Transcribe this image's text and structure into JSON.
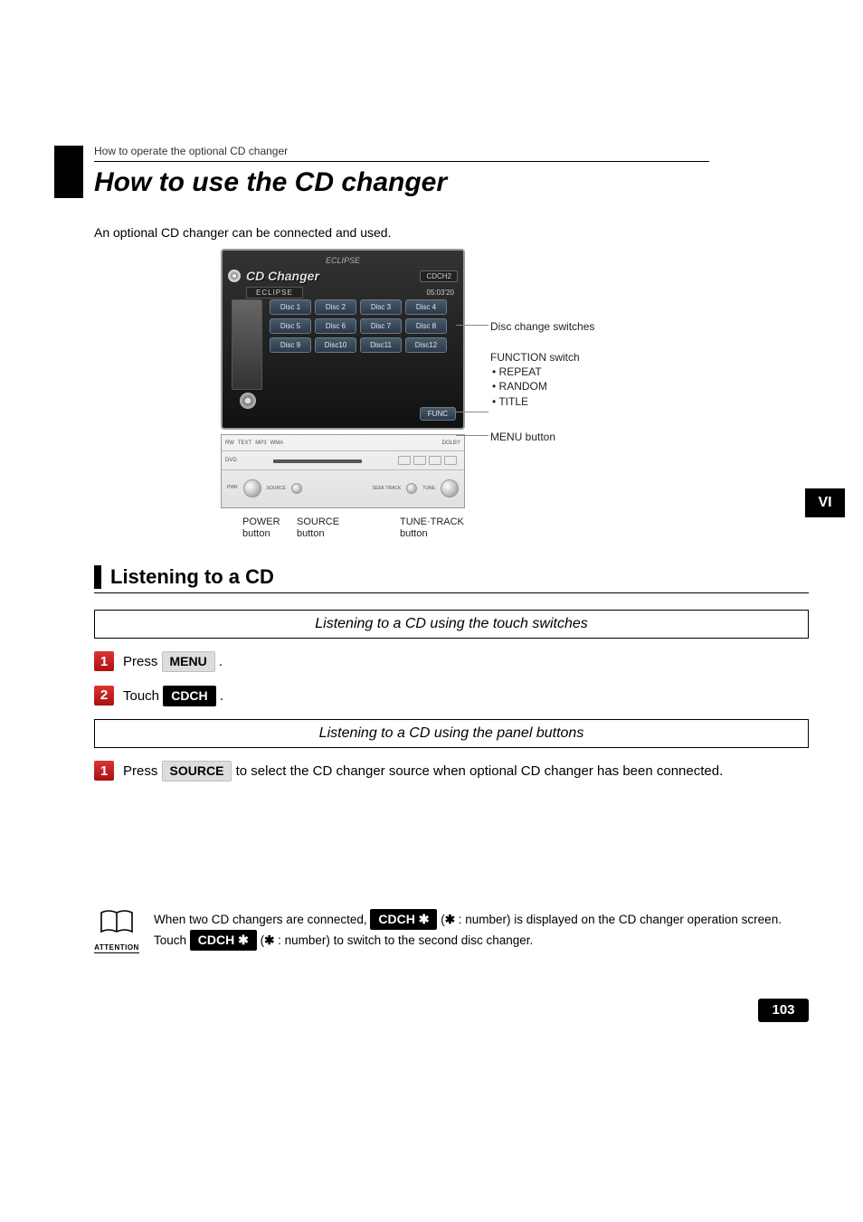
{
  "breadcrumb": "How to operate the optional CD changer",
  "title": "How to use the CD changer",
  "intro": "An optional CD changer can be connected and used.",
  "section_tab": "VI",
  "screen": {
    "brand": "ECLIPSE",
    "title": "CD Changer",
    "cdch_badge": "CDCH2",
    "eclipse_badge": "ECLIPSE",
    "time": "05:03'20",
    "discs": [
      "Disc 1",
      "Disc 2",
      "Disc 3",
      "Disc 4",
      "Disc 5",
      "Disc 6",
      "Disc 7",
      "Disc 8",
      "Disc 9",
      "Disc10",
      "Disc11",
      "Disc12"
    ],
    "func": "FUNC"
  },
  "callouts": {
    "disc_change": "Disc change switches",
    "function_switch": "FUNCTION switch",
    "func_items": [
      "REPEAT",
      "RANDOM",
      "TITLE"
    ],
    "menu_button": "MENU button",
    "power_button_l1": "POWER",
    "power_button_l2": "button",
    "source_button_l1": "SOURCE",
    "source_button_l2": "button",
    "tune_button_l1": "TUNE·TRACK",
    "tune_button_l2": "button"
  },
  "section_head": "Listening to a CD",
  "subhead_touch": "Listening to a CD using the touch switches",
  "steps_touch": {
    "s1_pre": "Press ",
    "s1_btn": "MENU",
    "s1_post": " .",
    "s2_pre": "Touch ",
    "s2_btn": "CDCH",
    "s2_post": " ."
  },
  "subhead_panel": "Listening to a CD using the panel buttons",
  "steps_panel": {
    "s1_pre": "Press ",
    "s1_btn": "SOURCE",
    "s1_post": " to select the CD changer source when optional CD changer has been connected."
  },
  "attention": {
    "label": "ATTENTION",
    "t1": "When two CD changers are connected, ",
    "btn1": "CDCH ✱",
    "t2": "  (",
    "star": "✱",
    "t3": " : number) is displayed on the CD changer operation screen. Touch ",
    "btn2": "CDCH ✱",
    "t4": "  (",
    "t5": " : number) to switch to the second disc changer."
  },
  "page_number": "103"
}
